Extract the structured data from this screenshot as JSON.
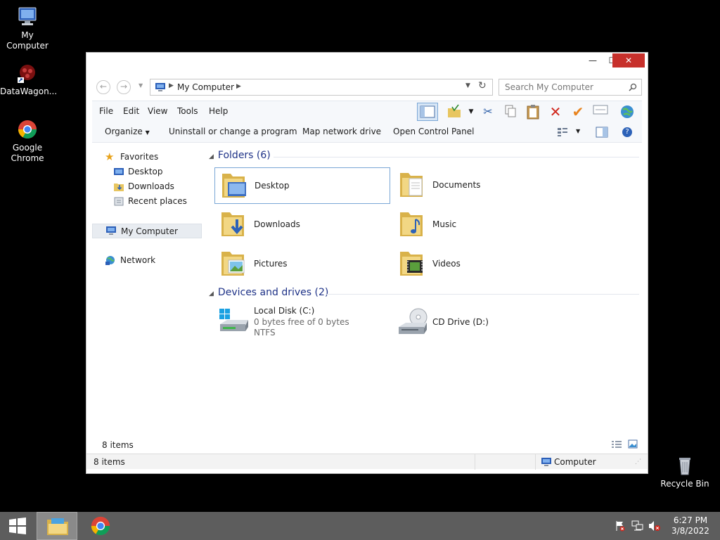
{
  "desktop": {
    "icons": [
      {
        "label": "My Computer"
      },
      {
        "label": "DataWagon..."
      },
      {
        "label": "Google\nChrome"
      },
      {
        "label": "Recycle Bin"
      }
    ]
  },
  "window": {
    "title_buttons": {
      "minimize": "—",
      "maximize": "☐",
      "close": "✕"
    },
    "address": {
      "path": "My Computer",
      "back": "←",
      "forward": "→"
    },
    "search": {
      "placeholder": "Search My Computer"
    },
    "menu": [
      "File",
      "Edit",
      "View",
      "Tools",
      "Help"
    ],
    "commands": {
      "organize": "Organize",
      "uninstall": "Uninstall or change a program",
      "map_drive": "Map network drive",
      "control_panel": "Open Control Panel"
    },
    "nav": {
      "favorites": "Favorites",
      "desktop": "Desktop",
      "downloads": "Downloads",
      "recent": "Recent places",
      "my_computer": "My Computer",
      "network": "Network"
    },
    "folders_header": "Folders (6)",
    "folders": [
      {
        "name": "Desktop"
      },
      {
        "name": "Documents"
      },
      {
        "name": "Downloads"
      },
      {
        "name": "Music"
      },
      {
        "name": "Pictures"
      },
      {
        "name": "Videos"
      }
    ],
    "devices_header": "Devices and drives (2)",
    "drives": [
      {
        "name": "Local Disk (C:)",
        "free": "0 bytes free of 0 bytes",
        "fs": "NTFS"
      },
      {
        "name": "CD Drive (D:)"
      }
    ],
    "details_count": "8 items",
    "status": {
      "count": "8 items",
      "location": "Computer"
    }
  },
  "taskbar": {
    "time": "6:27 PM",
    "date": "3/8/2022"
  },
  "colors": {
    "accent": "#1e3287",
    "close": "#c7302b",
    "taskbar": "#5d5d5d",
    "folder": "#e8c660"
  }
}
